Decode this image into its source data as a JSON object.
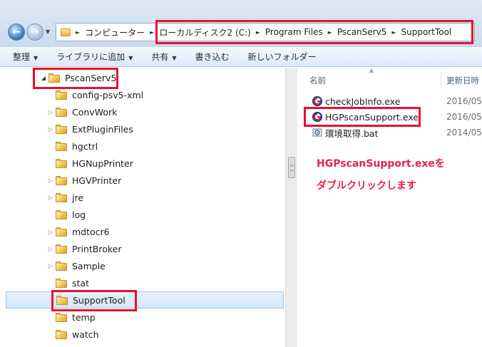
{
  "address": {
    "segments": [
      "コンピューター",
      "ローカルディスク2 (C:)",
      "Program Files",
      "PscanServ5",
      "SupportTool"
    ]
  },
  "toolbar": {
    "organize": "整理",
    "add_to_library": "ライブラリに追加",
    "share": "共有",
    "burn": "書き込む",
    "new_folder": "新しいフォルダー"
  },
  "tree": {
    "root": "PscanServ5",
    "items": [
      {
        "label": "config-psv5-xml",
        "expandable": false
      },
      {
        "label": "ConvWork",
        "expandable": true
      },
      {
        "label": "ExtPluginFiles",
        "expandable": true
      },
      {
        "label": "hgctrl",
        "expandable": false
      },
      {
        "label": "HGNupPrinter",
        "expandable": false
      },
      {
        "label": "HGVPrinter",
        "expandable": true
      },
      {
        "label": "jre",
        "expandable": true
      },
      {
        "label": "log",
        "expandable": false
      },
      {
        "label": "mdtocr6",
        "expandable": true
      },
      {
        "label": "PrintBroker",
        "expandable": true
      },
      {
        "label": "Sample",
        "expandable": true
      },
      {
        "label": "stat",
        "expandable": false
      },
      {
        "label": "SupportTool",
        "expandable": false
      },
      {
        "label": "temp",
        "expandable": false
      },
      {
        "label": "watch",
        "expandable": false
      }
    ]
  },
  "files": {
    "col_name": "名前",
    "col_date": "更新日時",
    "items": [
      {
        "name": "checkJobInfo.exe",
        "date": "2016/05/"
      },
      {
        "name": "HGPscanSupport.exe",
        "date": "2016/05/"
      },
      {
        "name": "環境取得.bat",
        "date": "2014/05/"
      }
    ]
  },
  "annotation": {
    "line1": "HGPscanSupport.exeを",
    "line2": "ダブルクリックします"
  },
  "colors": {
    "highlight": "#e8102e",
    "annotation": "#e8204a"
  }
}
